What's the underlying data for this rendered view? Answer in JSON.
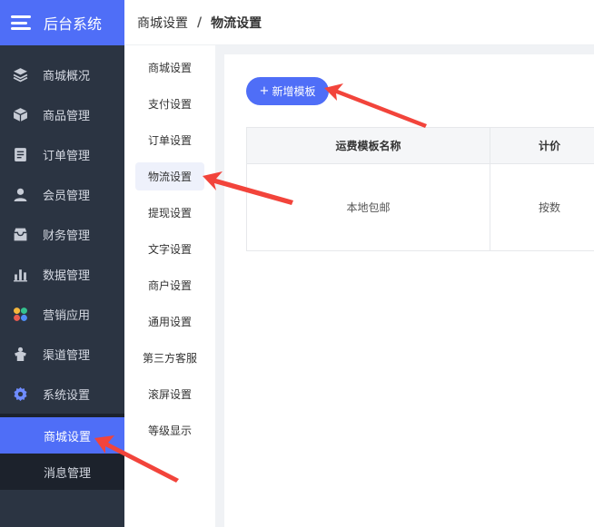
{
  "app": {
    "title": "后台系统"
  },
  "sidebar": {
    "items": [
      {
        "label": "商城概况",
        "icon": "layers-icon"
      },
      {
        "label": "商品管理",
        "icon": "box-icon"
      },
      {
        "label": "订单管理",
        "icon": "document-icon"
      },
      {
        "label": "会员管理",
        "icon": "user-icon"
      },
      {
        "label": "财务管理",
        "icon": "wallet-icon"
      },
      {
        "label": "数据管理",
        "icon": "bar-chart-icon"
      },
      {
        "label": "营销应用",
        "icon": "apps-icon"
      },
      {
        "label": "渠道管理",
        "icon": "shirt-icon"
      },
      {
        "label": "系统设置",
        "icon": "gear-icon"
      }
    ],
    "submenu": [
      {
        "label": "商城设置",
        "active": true
      },
      {
        "label": "消息管理",
        "active": false
      }
    ]
  },
  "breadcrumb": {
    "parent": "商城设置",
    "separator": "/",
    "current": "物流设置"
  },
  "subnav": {
    "items": [
      {
        "label": "商城设置"
      },
      {
        "label": "支付设置"
      },
      {
        "label": "订单设置"
      },
      {
        "label": "物流设置",
        "active": true
      },
      {
        "label": "提现设置"
      },
      {
        "label": "文字设置"
      },
      {
        "label": "商户设置"
      },
      {
        "label": "通用设置"
      },
      {
        "label": "第三方客服"
      },
      {
        "label": "滚屏设置"
      },
      {
        "label": "等级显示"
      }
    ]
  },
  "main": {
    "add_button": {
      "plus": "+",
      "label": "新增模板"
    },
    "table": {
      "headers": [
        "运费模板名称",
        "计价"
      ],
      "rows": [
        [
          "本地包邮",
          "按数"
        ]
      ]
    }
  },
  "colors": {
    "accent": "#4f6ef7",
    "sidebar_bg": "#2b3442",
    "submenu_bg": "#1c222c",
    "annotation_arrow": "#f2443b"
  }
}
